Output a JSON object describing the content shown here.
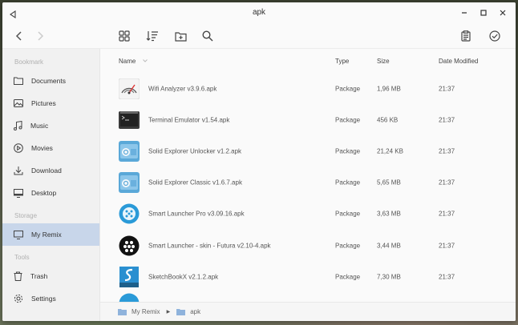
{
  "window": {
    "title": "apk"
  },
  "sidebar": {
    "sections": [
      {
        "label": "Bookmark"
      },
      {
        "label": "Storage"
      },
      {
        "label": "Tools"
      }
    ],
    "items": [
      {
        "label": "Documents",
        "icon": "folder-icon"
      },
      {
        "label": "Pictures",
        "icon": "image-icon"
      },
      {
        "label": "Music",
        "icon": "music-icon"
      },
      {
        "label": "Movies",
        "icon": "play-circle-icon"
      },
      {
        "label": "Download",
        "icon": "download-icon"
      },
      {
        "label": "Desktop",
        "icon": "monitor-icon"
      },
      {
        "label": "My Remix",
        "icon": "monitor-icon",
        "active": true
      },
      {
        "label": "Trash",
        "icon": "trash-icon"
      },
      {
        "label": "Settings",
        "icon": "gear-icon"
      }
    ]
  },
  "table": {
    "headers": {
      "name": "Name",
      "type": "Type",
      "size": "Size",
      "date": "Date Modified"
    },
    "rows": [
      {
        "name": "Wifi Analyzer v3.9.6.apk",
        "type": "Package",
        "size": "1,96 MB",
        "date": "21:37",
        "icon": "wifi-analyzer-icon"
      },
      {
        "name": "Terminal Emulator v1.54.apk",
        "type": "Package",
        "size": "456 KB",
        "date": "21:37",
        "icon": "terminal-icon"
      },
      {
        "name": "Solid Explorer Unlocker v1.2.apk",
        "type": "Package",
        "size": "21,24 KB",
        "date": "21:37",
        "icon": "solid-explorer-icon"
      },
      {
        "name": "Solid Explorer Classic v1.6.7.apk",
        "type": "Package",
        "size": "5,65 MB",
        "date": "21:37",
        "icon": "solid-explorer-icon"
      },
      {
        "name": "Smart Launcher Pro v3.09.16.apk",
        "type": "Package",
        "size": "3,63 MB",
        "date": "21:37",
        "icon": "smart-launcher-icon"
      },
      {
        "name": "Smart Launcher - skin - Futura v2.10-4.apk",
        "type": "Package",
        "size": "3,44 MB",
        "date": "21:37",
        "icon": "smart-launcher-dark-icon"
      },
      {
        "name": "SketchBookX v2.1.2.apk",
        "type": "Package",
        "size": "7,30 MB",
        "date": "21:37",
        "icon": "sketchbook-icon"
      }
    ]
  },
  "pathbar": {
    "segments": [
      "My Remix",
      "apk"
    ]
  },
  "colors": {
    "accent": "#c8d6ea",
    "folder": "#8fb3dc"
  }
}
